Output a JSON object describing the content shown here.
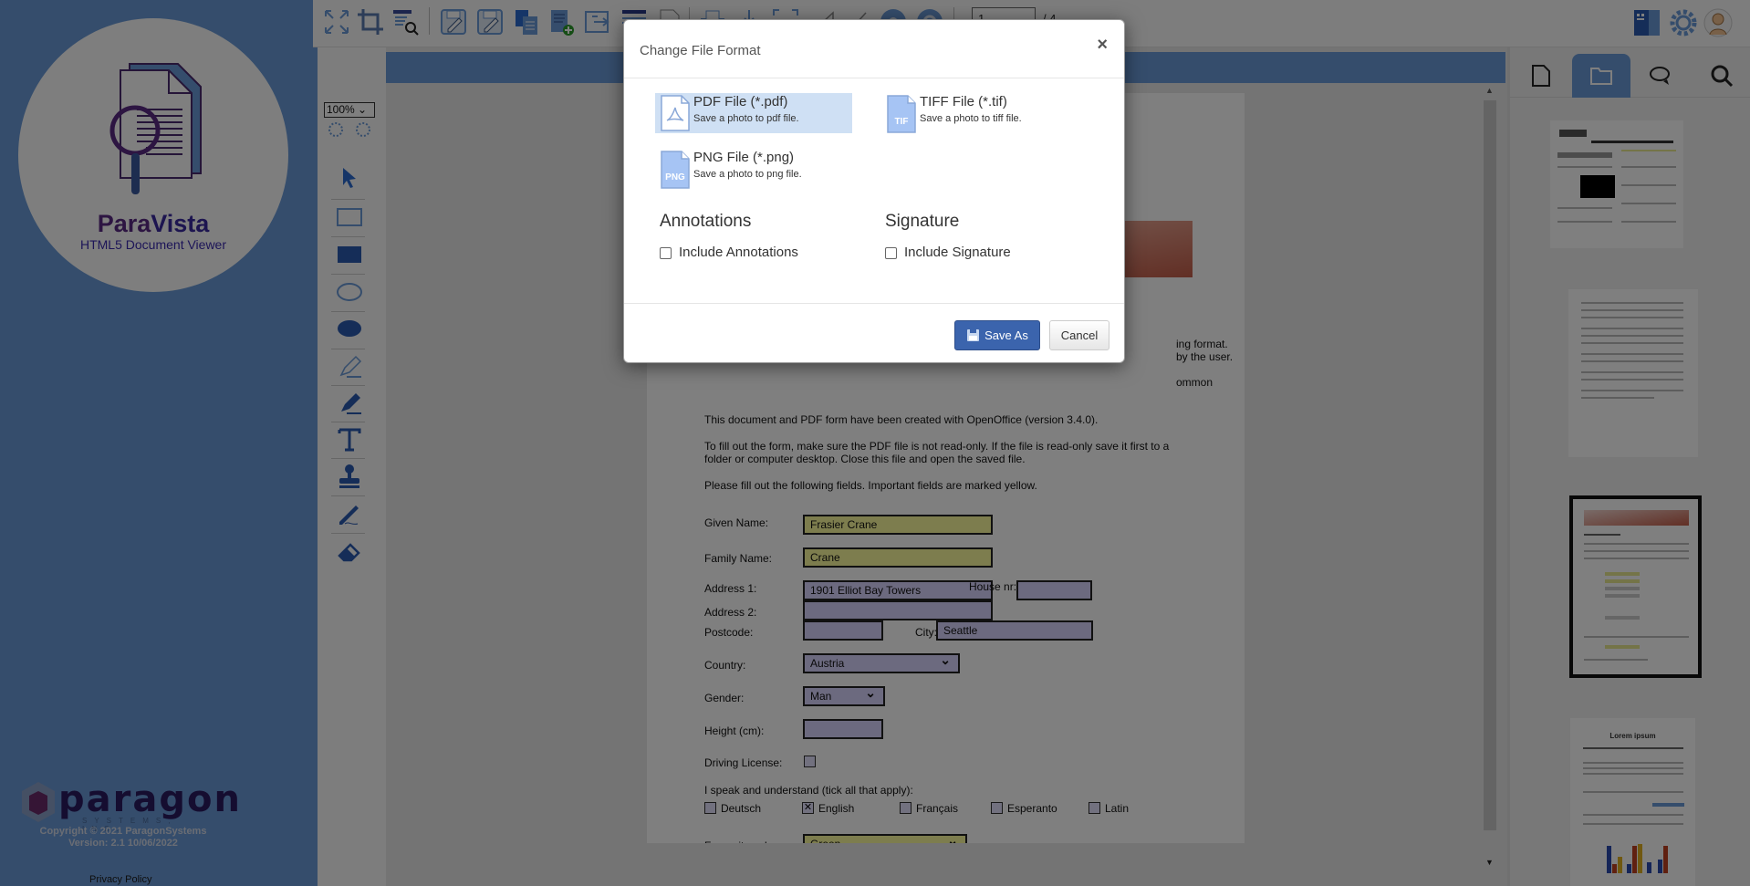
{
  "app": {
    "name_part1": "Para",
    "name_part2": "Vista",
    "subtitle": "HTML5 Document Viewer",
    "company": "paragon",
    "company_sub": "SYSTEMS, INC.",
    "copyright": "Copyright © 2021 ParagonSystems",
    "version": "Version: 2.1 10/06/2022",
    "privacy_link": "Privacy Policy",
    "accent_color": "#6b9bd8"
  },
  "toolbar": {
    "icons": [
      "fit-page-icon",
      "crop-icon",
      "find-text-icon",
      "save-icon",
      "save-as-icon",
      "copy-icon",
      "add-page-icon",
      "export-icon",
      "list-icon",
      "blank-page-icon",
      "print-icon",
      "download-icon",
      "ocr-icon",
      "line-icon",
      "freehand-icon",
      "zoom-in-icon",
      "zoom-out-icon"
    ],
    "page_number": "1",
    "page_total": "/ 4",
    "right_icons": [
      "panel-toggle-icon",
      "settings-icon",
      "user-avatar-icon"
    ]
  },
  "tools": {
    "zoom_level": "100%",
    "items": [
      "select-arrow",
      "rectangle-outline",
      "rectangle-filled",
      "ellipse-outline",
      "ellipse-filled",
      "highlighter-outline",
      "highlighter-filled",
      "text",
      "stamp",
      "signature-pen",
      "eraser"
    ]
  },
  "document": {
    "partial_line1": "ing format.",
    "partial_line2": "by the user.",
    "partial_line3": "ommon",
    "para1": "This document and PDF form have been created with OpenOffice (version 3.4.0).",
    "para2a": "To fill out the form, make sure the PDF file is not read-only. If the file is read-only save it first to a",
    "para2b": "folder or computer desktop. Close this file and open the saved file.",
    "para3": "Please fill out the following fields. Important fields are marked yellow.",
    "fields": {
      "given_name_label": "Given Name:",
      "given_name": "Frasier Crane",
      "family_name_label": "Family Name:",
      "family_name": "Crane",
      "address1_label": "Address 1:",
      "address1": "1901 Elliot Bay Towers",
      "house_nr_label": "House nr:",
      "house_nr": "",
      "address2_label": "Address 2:",
      "address2": "",
      "postcode_label": "Postcode:",
      "postcode": "",
      "city_label": "City:",
      "city": "Seattle",
      "country_label": "Country:",
      "country": "Austria",
      "gender_label": "Gender:",
      "gender": "Man",
      "height_label": "Height (cm):",
      "height": "",
      "driving_license_label": "Driving License:",
      "driving_license": false,
      "languages_label": "I speak and understand (tick all that apply):",
      "languages": [
        {
          "label": "Deutsch",
          "checked": false
        },
        {
          "label": "English",
          "checked": true
        },
        {
          "label": "Français",
          "checked": false
        },
        {
          "label": "Esperanto",
          "checked": false
        },
        {
          "label": "Latin",
          "checked": false
        }
      ],
      "colour_label": "Favourite colour:",
      "colour": "Green"
    }
  },
  "right_panel": {
    "tabs": [
      "page-tab",
      "folder-tab",
      "comments-tab",
      "search-tab"
    ],
    "active_tab": "folder-tab",
    "thumbnails": [
      {
        "page": 1,
        "selected": false
      },
      {
        "page": 2,
        "selected": false
      },
      {
        "page": 3,
        "selected": true
      },
      {
        "page": 4,
        "selected": false,
        "title": "Lorem ipsum"
      }
    ]
  },
  "dialog": {
    "title": "Change File Format",
    "close_label": "×",
    "formats": [
      {
        "name": "PDF File (*.pdf)",
        "desc": "Save a photo to pdf file.",
        "selected": true
      },
      {
        "name": "TIFF File (*.tif)",
        "desc": "Save a photo to tiff file.",
        "selected": false,
        "badge": "TIF"
      },
      {
        "name": "PNG File (*.png)",
        "desc": "Save a photo to png file.",
        "selected": false,
        "badge": "PNG"
      }
    ],
    "annotations_heading": "Annotations",
    "include_annotations": "Include Annotations",
    "include_annotations_checked": false,
    "signature_heading": "Signature",
    "include_signature": "Include Signature",
    "include_signature_checked": false,
    "save_as_label": "Save As",
    "cancel_label": "Cancel"
  }
}
